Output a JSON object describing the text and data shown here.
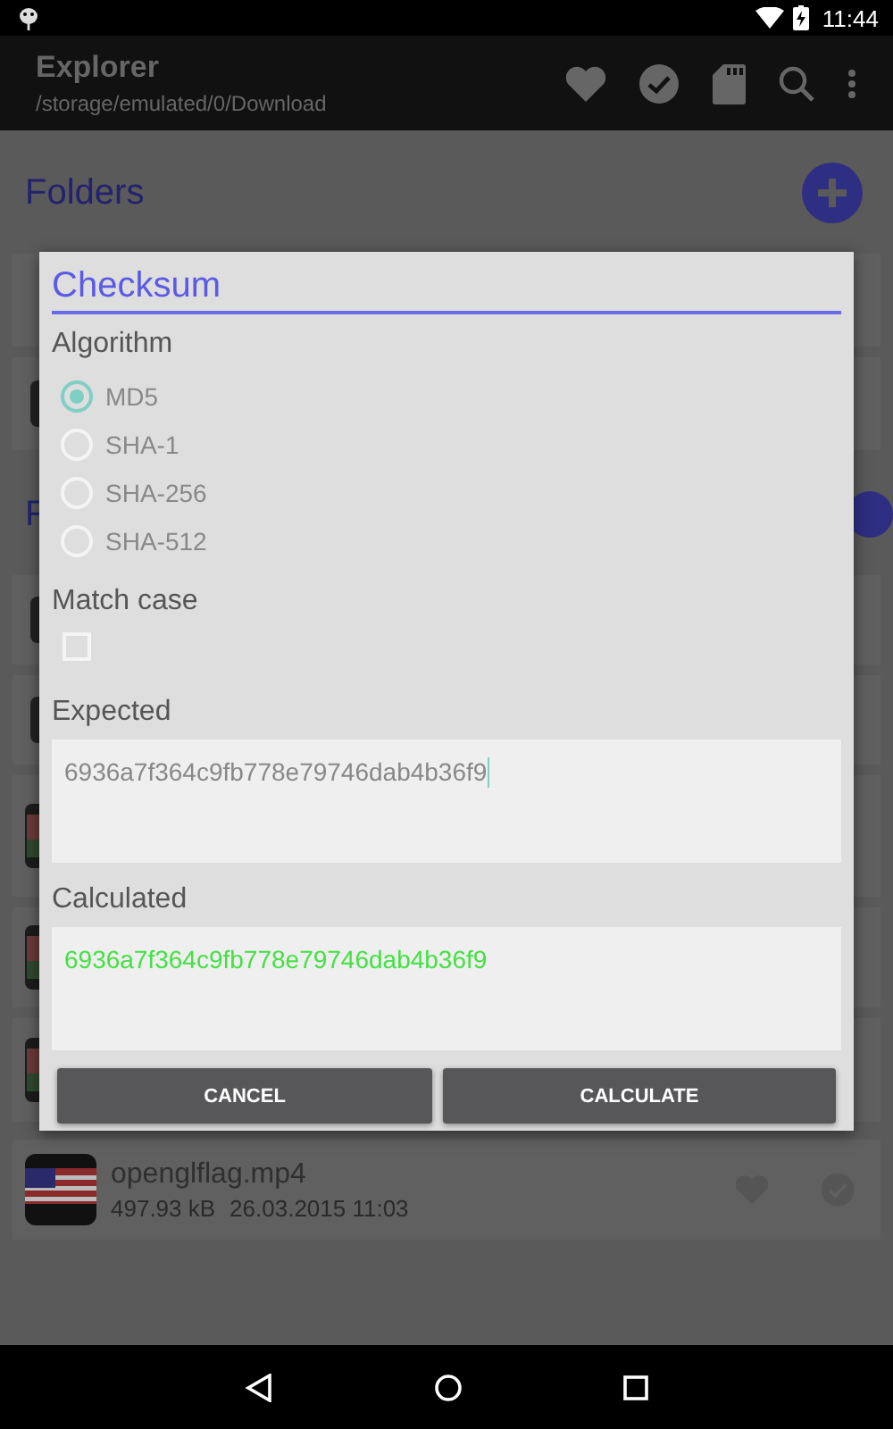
{
  "status_bar": {
    "time": "11:44"
  },
  "app_bar": {
    "title": "Explorer",
    "subtitle": "/storage/emulated/0/Download"
  },
  "folders_header": {
    "label": "Folders"
  },
  "files_header": {
    "label": "F"
  },
  "files": [
    {
      "name": "openglflag.mp4",
      "size": "497.93 kB",
      "modified": "26.03.2015 11:03"
    }
  ],
  "dialog": {
    "title": "Checksum",
    "algorithm_label": "Algorithm",
    "algorithms": [
      {
        "label": "MD5",
        "selected": true
      },
      {
        "label": "SHA-1",
        "selected": false
      },
      {
        "label": "SHA-256",
        "selected": false
      },
      {
        "label": "SHA-512",
        "selected": false
      }
    ],
    "match_case": {
      "label": "Match case",
      "checked": false
    },
    "expected": {
      "label": "Expected",
      "value": "6936a7f364c9fb778e79746dab4b36f9"
    },
    "calculated": {
      "label": "Calculated",
      "value": "6936a7f364c9fb778e79746dab4b36f9"
    },
    "buttons": [
      "CANCEL",
      "CALCULATE"
    ]
  }
}
